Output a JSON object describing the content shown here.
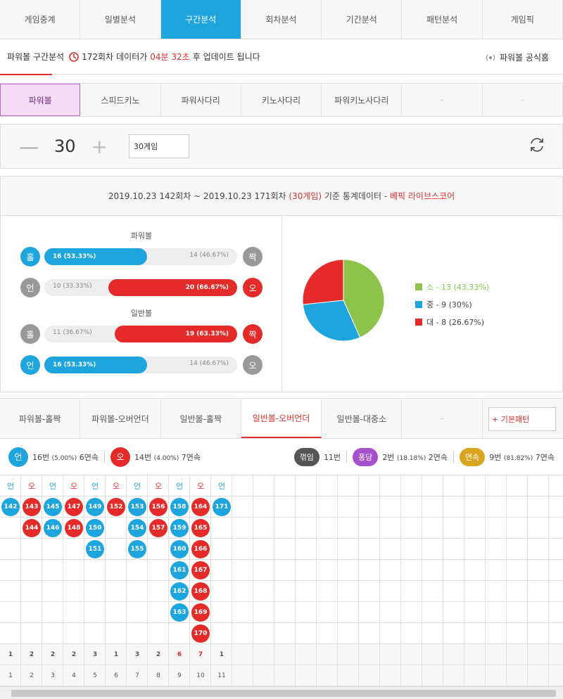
{
  "nav": [
    "게임중계",
    "일별분석",
    "구간분석",
    "회차분석",
    "기간분석",
    "패턴분석",
    "게임픽"
  ],
  "nav_active": 2,
  "info": {
    "prefix": "파워볼 구간분석",
    "round": "172회차",
    "mid": "데이터가",
    "time": "04분 32초",
    "suffix": "후 업데이트 됩니다",
    "home": "파워볼 공식홈"
  },
  "subtabs": [
    "파워볼",
    "스피드키노",
    "파워사다리",
    "키노사다리",
    "파워키노사다리",
    "-",
    "-"
  ],
  "counter": {
    "value": "30",
    "minus": "—",
    "plus": "+",
    "select": "30게임"
  },
  "stat": {
    "range": "2019.10.23 142회차 ~ 2019.10.23 171회차",
    "games": "(30게임)",
    "basis": "기준 통계데이터 -",
    "brand": "베픽 라이브스코어"
  },
  "powerball_label": "파워볼",
  "normal_label": "일반볼",
  "bars": [
    {
      "l": "홀",
      "r": "짝",
      "lv": "16 (53.33%)",
      "rv": "14 (46.67%)",
      "lc": "blue",
      "rc": "gray",
      "fill": "left",
      "pct": 53.33
    },
    {
      "l": "언",
      "r": "오",
      "lv": "10 (33.33%)",
      "rv": "20 (66.67%)",
      "lc": "gray",
      "rc": "red",
      "fill": "right",
      "pct": 66.67
    },
    {
      "l": "홀",
      "r": "짝",
      "lv": "11 (36.67%)",
      "rv": "19 (63.33%)",
      "lc": "gray",
      "rc": "red",
      "fill": "right",
      "pct": 63.33
    },
    {
      "l": "언",
      "r": "오",
      "lv": "16 (53.33%)",
      "rv": "14 (46.67%)",
      "lc": "blue",
      "rc": "gray",
      "fill": "left",
      "pct": 53.33
    }
  ],
  "chart_data": {
    "type": "pie",
    "categories": [
      "소",
      "중",
      "대"
    ],
    "values": [
      13,
      9,
      8
    ],
    "labels": [
      "소 - 13 (43.33%)",
      "중 - 9 (30%)",
      "대 - 8 (26.67%)"
    ],
    "colors": [
      "#8dc34a",
      "#1ea5de",
      "#e52a2a"
    ]
  },
  "ptabs": [
    "파워볼-홀짝",
    "파워볼-오버언더",
    "일반볼-홀짝",
    "일반볼-오버언더",
    "일반볼-대중소",
    "-"
  ],
  "ptab_active": 3,
  "pattern_btn": "+ 기본패턴",
  "streak": {
    "un_icon": "언",
    "un_text": "16번",
    "un_pct": "(5.00%)",
    "un_run": "6연속",
    "o_icon": "오",
    "o_text": "14번",
    "o_pct": "(4.00%)",
    "o_run": "7연속",
    "break_label": "꺾임",
    "break_val": "11번",
    "pong_label": "퐁당",
    "pong_val": "2번",
    "pong_pct": "(18.18%)",
    "pong_run": "2연속",
    "yeon_label": "연속",
    "yeon_val": "9번",
    "yeon_pct": "(81.82%)",
    "yeon_run": "7연속"
  },
  "columns": [
    {
      "head": "언",
      "balls": [
        "142"
      ],
      "count": "1",
      "idx": "1"
    },
    {
      "head": "오",
      "balls": [
        "143",
        "144"
      ],
      "count": "2",
      "idx": "2"
    },
    {
      "head": "언",
      "balls": [
        "145",
        "146"
      ],
      "count": "2",
      "idx": "3"
    },
    {
      "head": "오",
      "balls": [
        "147",
        "148"
      ],
      "count": "2",
      "idx": "4"
    },
    {
      "head": "언",
      "balls": [
        "149",
        "150",
        "151"
      ],
      "count": "3",
      "idx": "5"
    },
    {
      "head": "오",
      "balls": [
        "152"
      ],
      "count": "1",
      "idx": "6"
    },
    {
      "head": "언",
      "balls": [
        "153",
        "154",
        "155"
      ],
      "count": "3",
      "idx": "7"
    },
    {
      "head": "오",
      "balls": [
        "156",
        "157"
      ],
      "count": "2",
      "idx": "8"
    },
    {
      "head": "언",
      "balls": [
        "158",
        "159",
        "160",
        "161",
        "162",
        "163"
      ],
      "count": "6",
      "idx": "9"
    },
    {
      "head": "오",
      "balls": [
        "164",
        "165",
        "166",
        "167",
        "168",
        "169",
        "170"
      ],
      "count": "7",
      "idx": "10"
    },
    {
      "head": "언",
      "balls": [
        "171"
      ],
      "count": "1",
      "idx": "11"
    }
  ],
  "colors": {
    "blue": "#1ea5de",
    "red": "#e52a2a",
    "gray": "#999999",
    "purple": "#a64fcf",
    "gold": "#d9a520",
    "dark": "#555555"
  }
}
